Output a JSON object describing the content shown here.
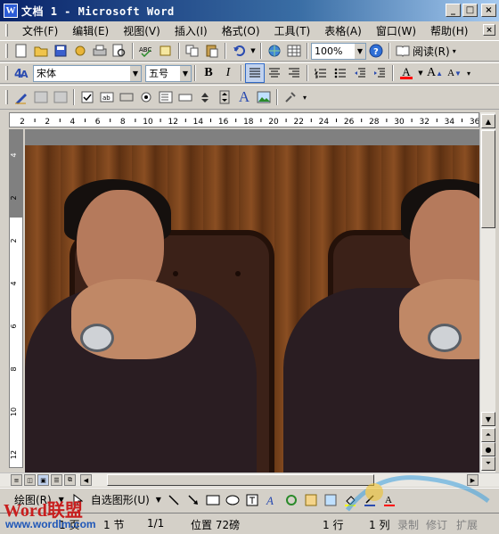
{
  "window": {
    "title": "文档 1 - Microsoft Word",
    "app_icon": "W",
    "minimize": "_",
    "maximize": "□",
    "close": "×"
  },
  "menubar": {
    "items": [
      "文件(F)",
      "编辑(E)",
      "视图(V)",
      "插入(I)",
      "格式(O)",
      "工具(T)",
      "表格(A)",
      "窗口(W)",
      "帮助(H)"
    ]
  },
  "standard_toolbar": {
    "zoom": "100%",
    "reading_mode": "阅读(R)"
  },
  "format_toolbar": {
    "font_name": "宋体",
    "font_size": "五号",
    "bold": "B",
    "italic": "I",
    "font_color_letter": "A",
    "grow_font": "A",
    "shrink_font": "A"
  },
  "ruler": {
    "h_ticks": [
      "2",
      "2",
      "4",
      "6",
      "8",
      "10",
      "12",
      "14",
      "16",
      "18",
      "20",
      "22",
      "24",
      "26",
      "28",
      "30",
      "32",
      "34",
      "36"
    ],
    "v_ticks": [
      "4",
      "2",
      "2",
      "4",
      "6",
      "8",
      "10",
      "12"
    ]
  },
  "drawing_toolbar": {
    "draw_label": "绘图(R)",
    "autoshapes_label": "自选图形(U)"
  },
  "statusbar": {
    "page": "1 页",
    "section": "1 节",
    "page_count": "1/1",
    "position": "位置 72磅",
    "line": "1 行",
    "column": "1 列",
    "record": "录制",
    "revision": "修订",
    "extend": "扩展"
  },
  "branding": {
    "logo_text": "Word联盟",
    "url": "www.wordlm.com"
  },
  "colors": {
    "titlebar_start": "#0a246a",
    "titlebar_end": "#a6caf0",
    "chrome": "#d4d0c8",
    "font_color_underline": "#ff0000"
  }
}
